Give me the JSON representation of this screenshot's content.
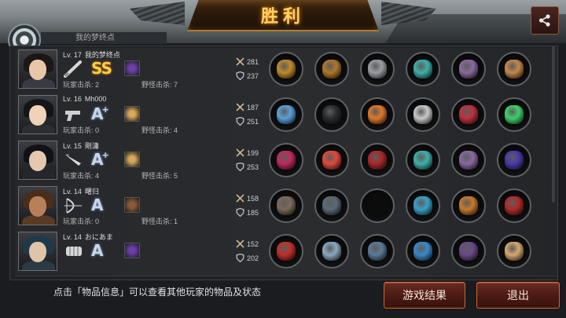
{
  "header": {
    "title": "胜利",
    "tab_label": "我的梦终点"
  },
  "icons": {
    "share": "share-icon",
    "attack": "crossed-swords-icon",
    "defense": "shield-icon"
  },
  "players": [
    {
      "level": "Lv. 17",
      "name": "我的梦终点",
      "grade": "SS",
      "grade_plus": "",
      "weapon": "bat",
      "player_kills": "玩家击杀: 2",
      "monster_kills": "野怪击杀: 7",
      "attack": "281",
      "defense": "237",
      "hair": "#1b1714",
      "skin": "#e8c7a8",
      "outfit": "#3a3a44",
      "badge_color": "#6b3fa8",
      "items": [
        "#c08a2a",
        "#b0772a",
        "#9a9ea3",
        "#3fb0a8",
        "#8a6aa0",
        "#c7884a"
      ]
    },
    {
      "level": "Lv. 16",
      "name": "Mh000",
      "grade": "A",
      "grade_plus": "+",
      "weapon": "pistol",
      "player_kills": "玩家击杀: 0",
      "monster_kills": "野怪击杀: 4",
      "attack": "187",
      "defense": "251",
      "hair": "#151517",
      "skin": "#efd2b8",
      "outfit": "#2d2d33",
      "badge_color": "#d8a85a",
      "items": [
        "#5aa0d8",
        "#2a2c30",
        "#e0782a",
        "#c8c8c8",
        "#c0303a",
        "#3fd06a"
      ]
    },
    {
      "level": "Lv. 15",
      "name": "剛瀟",
      "grade": "A",
      "grade_plus": "+",
      "weapon": "knife",
      "player_kills": "玩家击杀: 4",
      "monster_kills": "野怪击杀: 5",
      "attack": "199",
      "defense": "253",
      "hair": "#121216",
      "skin": "#e5c8b0",
      "outfit": "#26262c",
      "badge_color": "#d8a85a",
      "items": [
        "#c02a5a",
        "#e04a3a",
        "#a8282a",
        "#3fb0a8",
        "#8a6aa0",
        "#4a3aa8"
      ]
    },
    {
      "level": "Lv. 14",
      "name": "曙归",
      "grade": "A",
      "grade_plus": "",
      "weapon": "bow",
      "player_kills": "玩家击杀: 0",
      "monster_kills": "野怪击杀: 1",
      "attack": "158",
      "defense": "185",
      "hair": "#4a2e1c",
      "skin": "#b8805a",
      "outfit": "#5a3a24",
      "badge_color": "#8a5a3a",
      "items": [
        "#7a6a5a",
        "#5a6a78",
        "#0c0c0d",
        "#3aa0c8",
        "#c87a2a",
        "#b02a2a"
      ]
    },
    {
      "level": "Lv. 14",
      "name": "おにあま",
      "grade": "A",
      "grade_plus": "",
      "weapon": "fist",
      "player_kills": "",
      "monster_kills": "",
      "attack": "152",
      "defense": "202",
      "hair": "#1e3a48",
      "skin": "#e0c4a8",
      "outfit": "#2a3a44",
      "badge_color": "#6b3fa8",
      "items": [
        "#c0302a",
        "#8aa8c0",
        "#5a7a98",
        "#3a88c8",
        "#6a4a88",
        "#d8a870"
      ]
    }
  ],
  "footer": {
    "hint": "点击「物品信息」可以查看其他玩家的物品及状态",
    "result_button": "游戏结果",
    "exit_button": "退出"
  }
}
